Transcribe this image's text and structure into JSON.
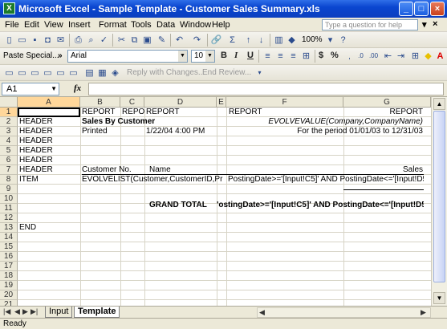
{
  "window": {
    "title": "Microsoft Excel - Sample Template - Customer Sales Summary.xls",
    "app_icon": "excel-icon",
    "buttons": [
      "minimize",
      "maximize",
      "close"
    ]
  },
  "menu": {
    "items": [
      "File",
      "Edit",
      "View",
      "Insert",
      "Format",
      "Tools",
      "Data",
      "Window",
      "Help"
    ],
    "help_placeholder": "Type a question for help"
  },
  "toolbar": {
    "zoom": "100%",
    "paste_special": "Paste Special...",
    "font_name": "Arial",
    "font_size": "10",
    "reply_with_changes": "Reply with Changes...",
    "end_review": "End Review...",
    "percent": "%",
    "currency": "$"
  },
  "formula_bar": {
    "name_box": "A1",
    "fx": "fx",
    "formula": ""
  },
  "grid": {
    "columns": [
      "A",
      "B",
      "C",
      "D",
      "E",
      "F",
      "G"
    ],
    "rows": [
      "1",
      "2",
      "3",
      "4",
      "5",
      "6",
      "7",
      "8",
      "9",
      "10",
      "11",
      "12",
      "13",
      "14",
      "15",
      "16",
      "17",
      "18",
      "19",
      "20",
      "21"
    ],
    "cells": {
      "A2": "HEADER",
      "A3": "HEADER",
      "A4": "HEADER",
      "A5": "HEADER",
      "A6": "HEADER",
      "A7": "HEADER",
      "A8": "ITEM",
      "A13": "END",
      "B1": "REPORT",
      "C1": "REPOI",
      "D1": "REPORT",
      "E1": "REPORT",
      "G1": "REPORT",
      "B2": "Sales By Customer",
      "F2": "EVOLVEVALUE(Company,CompanyName)",
      "B3": "Printed",
      "D3": "1/22/04 4:00 PM",
      "G3": "For the period 01/01/03 to 12/31/03",
      "B7": "Customer No.",
      "D7": "Name",
      "G7": "Sales",
      "B8": "EVOLVELIST(Customer,CustomerID,Pr",
      "F8": "PostingDate>='[Input!C5]' AND PostingDate<='[Input!D5]')",
      "D11": "GRAND TOTAL",
      "F11": "'ostingDate>='[Input!C5]' AND PostingDate<='[Input!D5]')"
    }
  },
  "sheets": {
    "tabs": [
      "Input",
      "Template"
    ],
    "active": "Template"
  },
  "status": {
    "text": "Ready"
  }
}
